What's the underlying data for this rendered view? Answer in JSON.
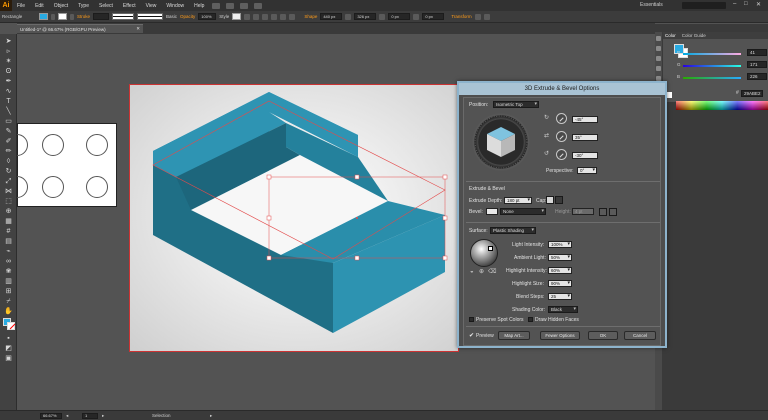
{
  "app": {
    "logo": "Ai",
    "menus": [
      "File",
      "Edit",
      "Object",
      "Type",
      "Select",
      "Effect",
      "View",
      "Window",
      "Help"
    ],
    "workspace": "Essentials",
    "colors": {
      "accent": "#29abe2",
      "shape_top": "#4bb7d6",
      "shape_side": "#1f6f86",
      "shape_front": "#2d93b1",
      "selection": "#e34b4b"
    }
  },
  "control_bar": {
    "object_type": "Rectangle",
    "stroke_label": "Stroke",
    "stroke_style": "Basic",
    "opacity_label": "Opacity",
    "opacity_value": "100%",
    "style_label": "Style",
    "shape_label": "Shape",
    "width_value": "440 px",
    "height_value": "326 px",
    "corner_value": "0 px",
    "corner_value_2": "0 px",
    "transform_label": "Transform"
  },
  "document": {
    "tab_title": "Untitled-1* @ 66.67% (RGB/GPU Preview)"
  },
  "color_panel": {
    "tabs": [
      "Color",
      "Color Guide"
    ],
    "r": {
      "label": "R",
      "value": "41"
    },
    "g": {
      "label": "G",
      "value": "171"
    },
    "b": {
      "label": "B",
      "value": "226"
    },
    "hex_prefix": "#",
    "hex": "29ABE2"
  },
  "status_bar": {
    "zoom": "66.67%",
    "page": "1",
    "tool": "Selection"
  },
  "dialog": {
    "title": "3D Extrude & Bevel Options",
    "position_label": "Position:",
    "position_value": "Isometric Top",
    "rot_x": "-45°",
    "rot_y": "35°",
    "rot_z": "-30°",
    "perspective_label": "Perspective:",
    "perspective_value": "0°",
    "extrude_section": "Extrude & Bevel",
    "extrude_depth_label": "Extrude Depth:",
    "extrude_depth_value": "180 pt",
    "cap_label": "Cap:",
    "bevel_label": "Bevel:",
    "bevel_value": "None",
    "height_label": "Height:",
    "height_value": "4 pt",
    "surface_label": "Surface:",
    "surface_value": "Plastic Shading",
    "light_intensity_label": "Light Intensity:",
    "light_intensity_value": "100%",
    "ambient_light_label": "Ambient Light:",
    "ambient_light_value": "50%",
    "highlight_intensity_label": "Highlight Intensity:",
    "highlight_intensity_value": "60%",
    "highlight_size_label": "Highlight Size:",
    "highlight_size_value": "90%",
    "blend_steps_label": "Blend Steps:",
    "blend_steps_value": "25",
    "shading_color_label": "Shading Color:",
    "shading_color_value": "Black",
    "preserve_spot": "Preserve Spot Colors",
    "draw_hidden": "Draw Hidden Faces",
    "preview_label": "Preview",
    "map_art_label": "Map Art...",
    "fewer_options_label": "Fewer Options",
    "ok_label": "OK",
    "cancel_label": "Cancel"
  }
}
